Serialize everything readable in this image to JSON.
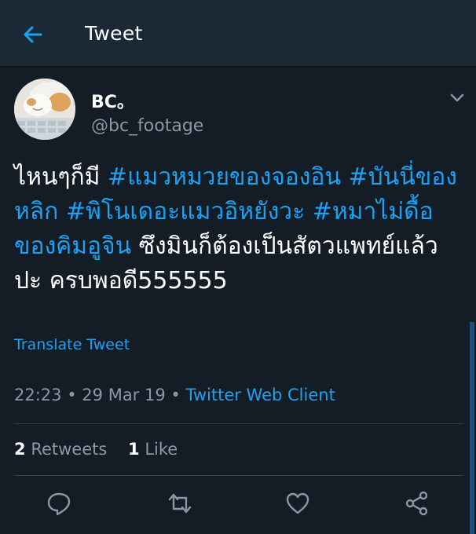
{
  "header": {
    "title": "Tweet",
    "back_icon": "arrow-left-icon",
    "accent": "#1da1f2"
  },
  "tweet": {
    "author_name": "BC。",
    "author_handle": "@bc_footage",
    "avatar_icon": "cat-avatar-image",
    "text_segments": [
      {
        "text": "ไหนๆก็มี ",
        "type": "text"
      },
      {
        "text": "#แมวหมวยของจองอิน",
        "type": "hashtag"
      },
      {
        "text": " ",
        "type": "text"
      },
      {
        "text": "#บันนี่ของหลิก",
        "type": "hashtag"
      },
      {
        "text": " ",
        "type": "text"
      },
      {
        "text": "#พิโนเดอะแมวอิหยังวะ",
        "type": "hashtag"
      },
      {
        "text": " ",
        "type": "text"
      },
      {
        "text": "#หมาไม่ดื้อของคิมอูจิน",
        "type": "hashtag"
      },
      {
        "text": "  ซึงมินก็ต้องเป็นสัตวแพทย์แล้วปะ ครบพอดี555555",
        "type": "text"
      }
    ],
    "translate_label": "Translate Tweet",
    "time": "22:23",
    "date": "29 Mar 19",
    "separator": "•",
    "client": "Twitter Web Client",
    "retweets_count": "2",
    "retweets_label": "Retweets",
    "likes_count": "1",
    "likes_label": "Like"
  },
  "actions": {
    "reply_icon": "reply-icon",
    "retweet_icon": "retweet-icon",
    "like_icon": "heart-icon",
    "share_icon": "share-icon"
  }
}
